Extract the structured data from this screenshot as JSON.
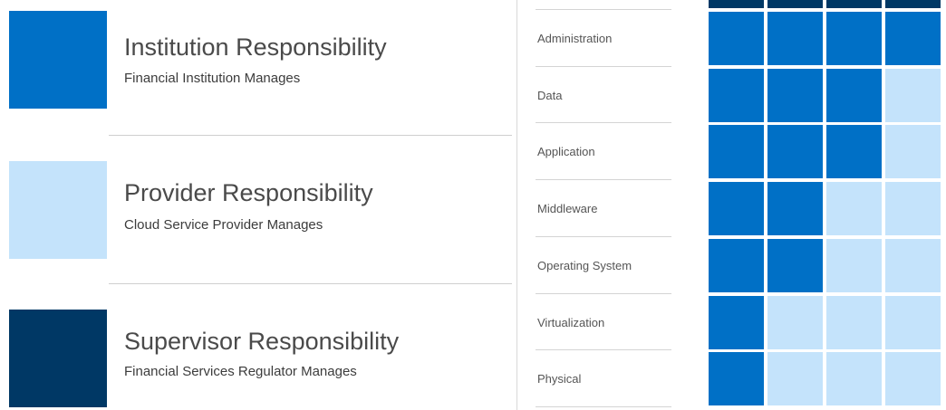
{
  "colors": {
    "institution": "#0070c6",
    "provider": "#c4e3fb",
    "supervisor": "#003865"
  },
  "legend": [
    {
      "key": "institution",
      "title": "Institution Responsibility",
      "subtitle": "Financial Institution Manages"
    },
    {
      "key": "provider",
      "title": "Provider Responsibility",
      "subtitle": "Cloud Service Provider Manages"
    },
    {
      "key": "supervisor",
      "title": "Supervisor Responsibility",
      "subtitle": "Financial Services Regulator Manages"
    }
  ],
  "layers": [
    "Administration",
    "Data",
    "Application",
    "Middleware",
    "Operating System",
    "Virtualization",
    "Physical"
  ],
  "matrix": {
    "column_count": 4,
    "header_row": [
      "supervisor",
      "supervisor",
      "supervisor",
      "supervisor"
    ],
    "rows": [
      [
        "institution",
        "institution",
        "institution",
        "institution"
      ],
      [
        "institution",
        "institution",
        "institution",
        "provider"
      ],
      [
        "institution",
        "institution",
        "institution",
        "provider"
      ],
      [
        "institution",
        "institution",
        "provider",
        "provider"
      ],
      [
        "institution",
        "institution",
        "provider",
        "provider"
      ],
      [
        "institution",
        "provider",
        "provider",
        "provider"
      ],
      [
        "institution",
        "provider",
        "provider",
        "provider"
      ]
    ]
  }
}
